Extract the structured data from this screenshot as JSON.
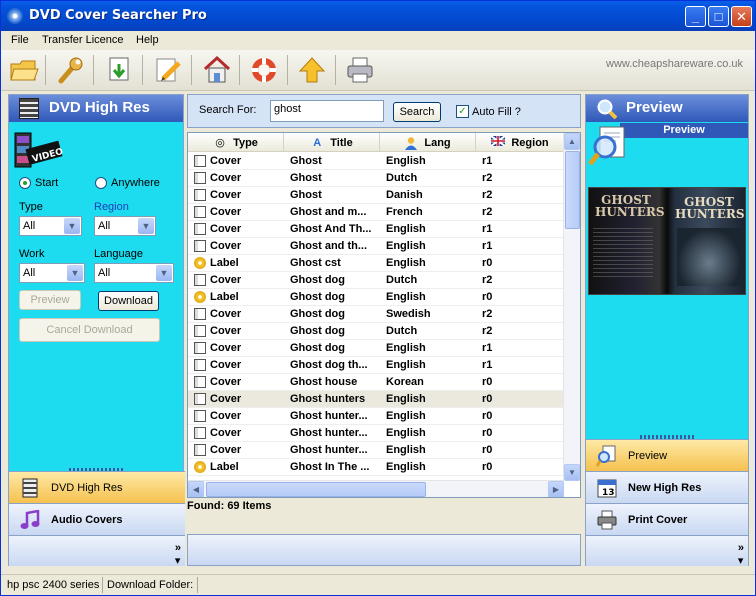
{
  "window": {
    "title": "DVD Cover Searcher Pro"
  },
  "menu": [
    "File",
    "Transfer Licence",
    "Help"
  ],
  "toolbar": {
    "icons": [
      "open-folder-icon",
      "wrench-icon",
      "download-icon",
      "pencil-icon",
      "home-icon",
      "lifebuoy-icon",
      "up-arrow-icon",
      "printer-icon"
    ],
    "site_url": "www.cheapshareware.co.uk"
  },
  "left": {
    "header": "DVD High Res",
    "radio_start": "Start",
    "radio_anywhere": "Anywhere",
    "type_label": "Type",
    "type_value": "All",
    "region_label": "Region",
    "region_value": "All",
    "work_label": "Work",
    "work_value": "All",
    "language_label": "Language",
    "language_value": "All",
    "preview_button": "Preview",
    "download_button": "Download",
    "cancel_button": "Cancel Download",
    "nav_active": "DVD High Res",
    "nav_audio": "Audio Covers"
  },
  "search": {
    "label": "Search For:",
    "value": "ghost",
    "button": "Search",
    "autofill": "Auto Fill ?"
  },
  "grid": {
    "columns": [
      "Type",
      "Title",
      "Lang",
      "Region"
    ],
    "rows": [
      {
        "type": "Cover",
        "title": "Ghost",
        "lang": "English",
        "region": "r1"
      },
      {
        "type": "Cover",
        "title": "Ghost",
        "lang": "Dutch",
        "region": "r2"
      },
      {
        "type": "Cover",
        "title": "Ghost",
        "lang": "Danish",
        "region": "r2"
      },
      {
        "type": "Cover",
        "title": "Ghost and m...",
        "lang": "French",
        "region": "r2"
      },
      {
        "type": "Cover",
        "title": "Ghost And Th...",
        "lang": "English",
        "region": "r1"
      },
      {
        "type": "Cover",
        "title": "Ghost and th...",
        "lang": "English",
        "region": "r1"
      },
      {
        "type": "Label",
        "title": "Ghost cst",
        "lang": "English",
        "region": "r0"
      },
      {
        "type": "Cover",
        "title": "Ghost dog",
        "lang": "Dutch",
        "region": "r2"
      },
      {
        "type": "Label",
        "title": "Ghost dog",
        "lang": "English",
        "region": "r0"
      },
      {
        "type": "Cover",
        "title": "Ghost dog",
        "lang": "Swedish",
        "region": "r2"
      },
      {
        "type": "Cover",
        "title": "Ghost dog",
        "lang": "Dutch",
        "region": "r2"
      },
      {
        "type": "Cover",
        "title": "Ghost dog",
        "lang": "English",
        "region": "r1"
      },
      {
        "type": "Cover",
        "title": "Ghost dog th...",
        "lang": "English",
        "region": "r1"
      },
      {
        "type": "Cover",
        "title": "Ghost house",
        "lang": "Korean",
        "region": "r0"
      },
      {
        "type": "Cover",
        "title": "Ghost hunters",
        "lang": "English",
        "region": "r0",
        "selected": true
      },
      {
        "type": "Cover",
        "title": "Ghost hunter...",
        "lang": "English",
        "region": "r0"
      },
      {
        "type": "Cover",
        "title": "Ghost hunter...",
        "lang": "English",
        "region": "r0"
      },
      {
        "type": "Cover",
        "title": "Ghost hunter...",
        "lang": "English",
        "region": "r0"
      },
      {
        "type": "Label",
        "title": "Ghost In The ...",
        "lang": "English",
        "region": "r0"
      }
    ],
    "found": "Found: 69 Items"
  },
  "right": {
    "header": "Preview",
    "sub_header": "Preview",
    "cover_text_left": "GHOST HUNTERS",
    "cover_text_right": "GHOST HUNTERS",
    "nav_preview": "Preview",
    "nav_newhighres": "New High Res",
    "nav_print": "Print Cover"
  },
  "status": {
    "printer": "hp psc 2400 series",
    "download_folder": "Download Folder:"
  }
}
